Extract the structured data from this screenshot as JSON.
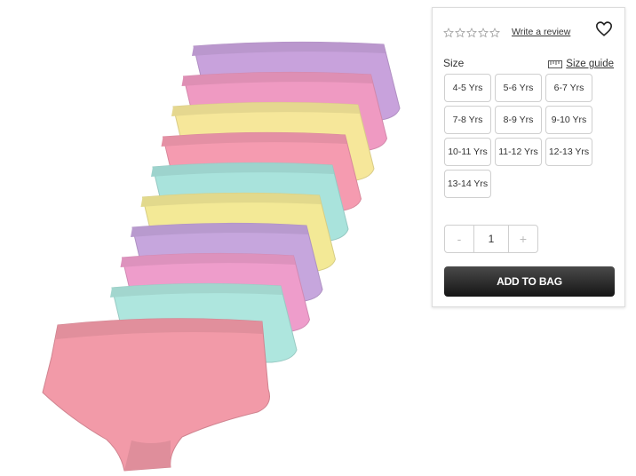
{
  "product": {
    "colors": [
      "#c8a2dc",
      "#ef9ac2",
      "#f6e79a",
      "#f59bb0",
      "#a9e3dc",
      "#f3e996",
      "#c6a6dd",
      "#ee9dcb",
      "#aee6de",
      "#f29aa8"
    ]
  },
  "rating": {
    "stars": 0,
    "review_link": "Write a review"
  },
  "size": {
    "label": "Size",
    "guide_label": "Size guide",
    "options": [
      "4-5 Yrs",
      "5-6 Yrs",
      "6-7 Yrs",
      "7-8 Yrs",
      "8-9 Yrs",
      "9-10 Yrs",
      "10-11 Yrs",
      "11-12 Yrs",
      "12-13 Yrs",
      "13-14 Yrs"
    ]
  },
  "quantity": {
    "minus": "-",
    "value": "1",
    "plus": "+"
  },
  "add_to_bag": "ADD TO BAG"
}
